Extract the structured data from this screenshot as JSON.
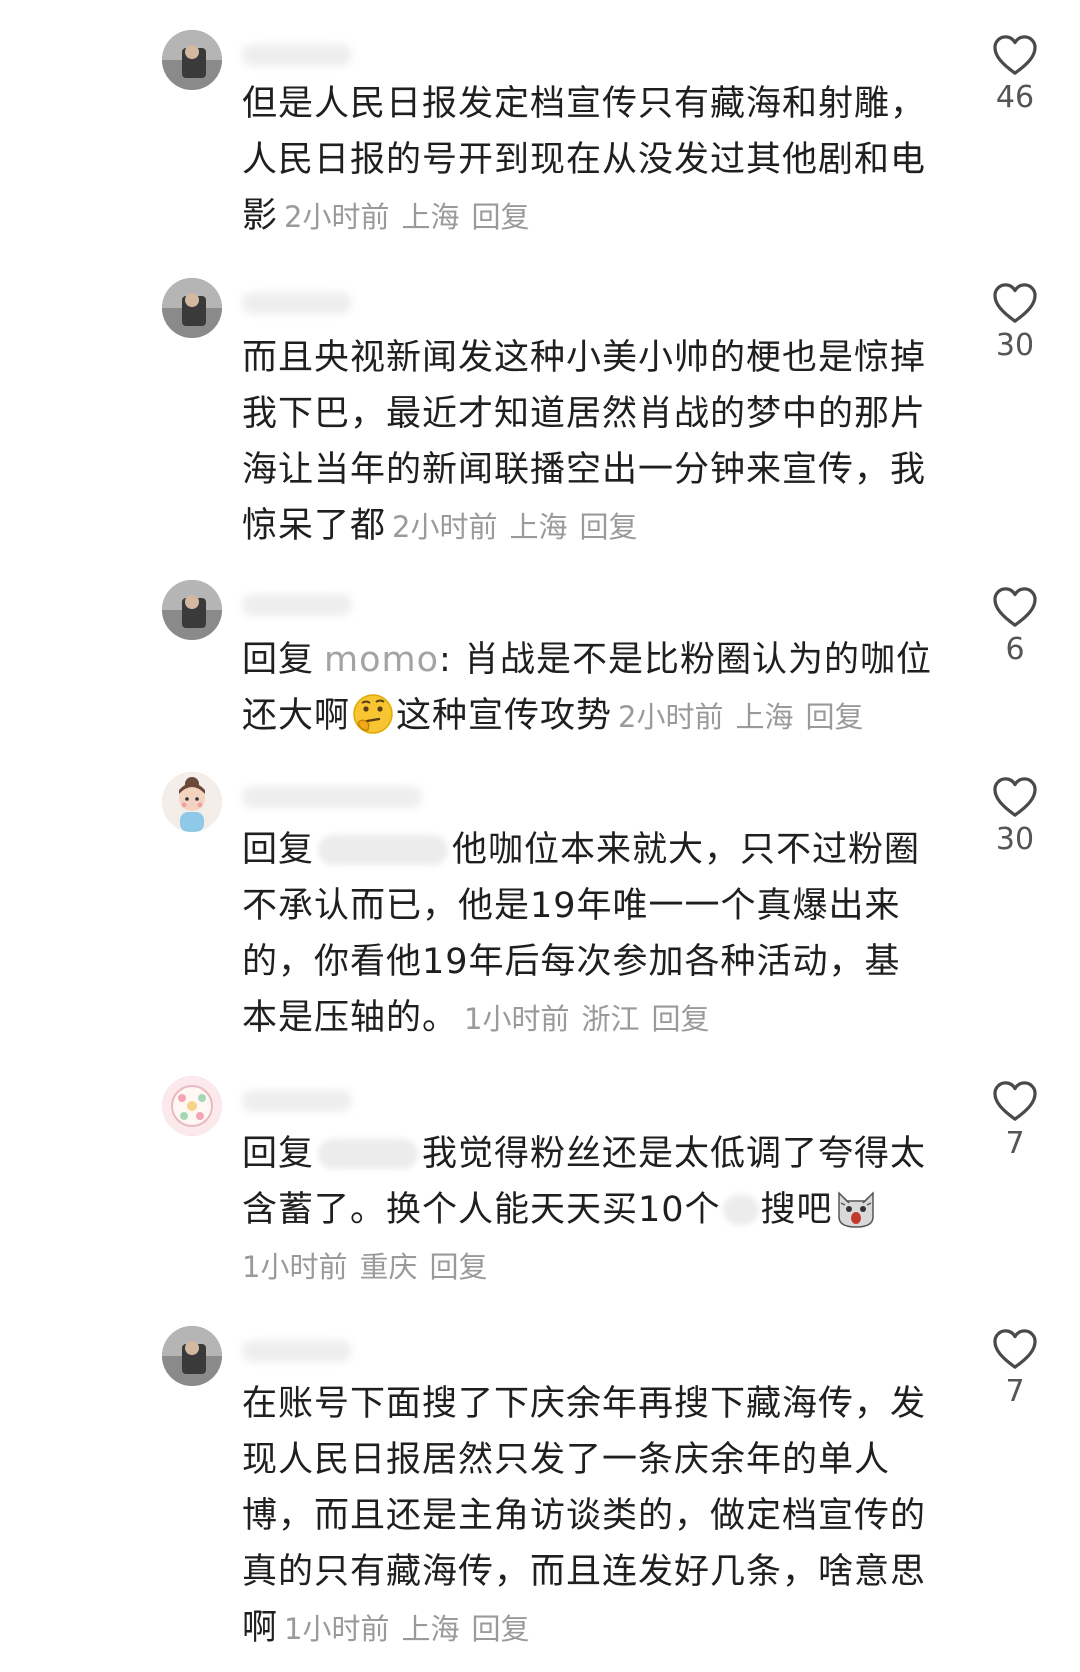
{
  "comments": [
    {
      "text": "但是人民日报发定档宣传只有藏海和射雕，人民日报的号开到现在从没发过其他剧和电影",
      "time": "2小时前",
      "location": "上海",
      "reply_label": "回复",
      "likes": "46"
    },
    {
      "text": "而且央视新闻发这种小美小帅的梗也是惊掉我下巴，最近才知道居然肖战的梦中的那片海让当年的新闻联播空出一分钟来宣传，我惊呆了都",
      "time": "2小时前",
      "location": "上海",
      "reply_label": "回复",
      "likes": "30"
    },
    {
      "reply_prefix": "回复",
      "reply_to": "momo",
      "text_a": ": 肖战是不是比粉圈认为的咖位还大啊",
      "emoji": "thinking-face",
      "text_b": "这种宣传攻势",
      "time": "2小时前",
      "location": "上海",
      "reply_label": "回复",
      "likes": "6"
    },
    {
      "reply_prefix": "回复",
      "text": "他咖位本来就大，只不过粉圈不承认而已，他是19年唯一一个真爆出来的，你看他19年后每次参加各种活动，基本是压轴的。",
      "time": "1小时前",
      "location": "浙江",
      "reply_label": "回复",
      "likes": "30"
    },
    {
      "reply_prefix": "回复",
      "text_a": "我觉得粉丝还是太低调了夸得太含蓄了。换个人能天天买10个",
      "text_b": "搜吧",
      "emoji": "shocked-cat",
      "time": "1小时前",
      "location": "重庆",
      "reply_label": "回复",
      "likes": "7"
    },
    {
      "text": "在账号下面搜了下庆余年再搜下藏海传，发现人民日报居然只发了一条庆余年的单人博，而且还是主角访谈类的，做定档宣传的真的只有藏海传，而且连发好几条，啥意思啊",
      "time": "1小时前",
      "location": "上海",
      "reply_label": "回复",
      "likes": "7"
    }
  ],
  "icons": {
    "like": "heart-outline-icon"
  },
  "colors": {
    "text": "#1f1f1f",
    "meta": "#9a9a9a",
    "background": "#ffffff"
  }
}
